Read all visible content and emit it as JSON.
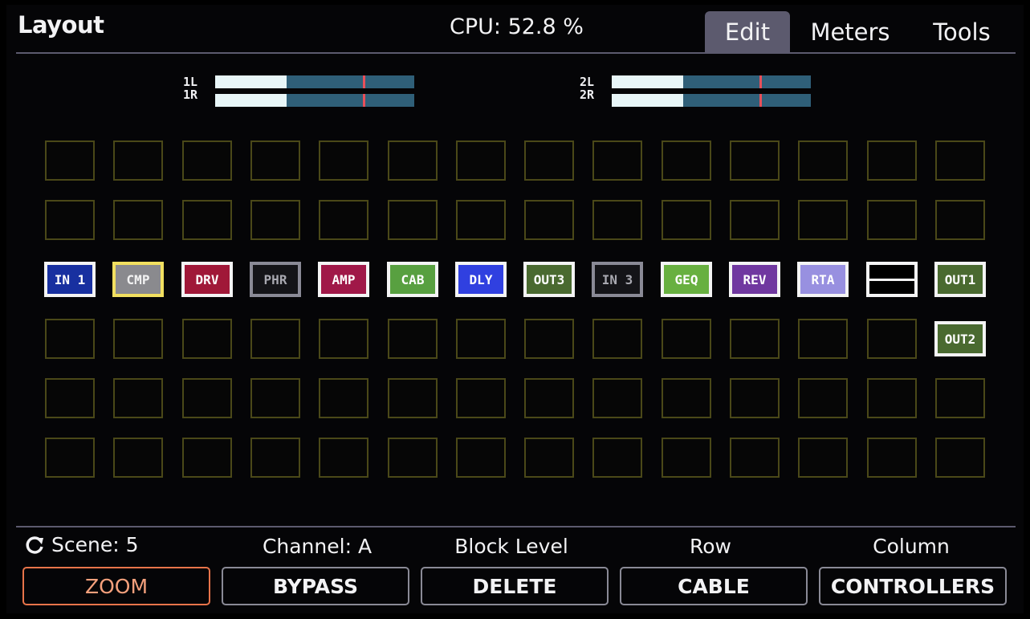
{
  "header": {
    "title": "Layout",
    "cpu": "CPU: 52.8 %",
    "tabs": [
      "Edit",
      "Meters",
      "Tools"
    ],
    "active_tab": "Edit"
  },
  "meters": [
    {
      "label_top": "1L",
      "label_bottom": "1R",
      "level": 0.36,
      "peak": 0.74
    },
    {
      "label_top": "2L",
      "label_bottom": "2R",
      "level": 0.36,
      "peak": 0.74
    }
  ],
  "grid": {
    "rows": 6,
    "columns": 14,
    "blocks": [
      {
        "row": 3,
        "col": 1,
        "label": "IN 1",
        "bg": "#1830a0",
        "border": "#f4f4f4",
        "text": "#ffffff"
      },
      {
        "row": 3,
        "col": 2,
        "label": "CMP",
        "bg": "#8a8a8e",
        "border": "#f2e060",
        "text": "#f2f2f2"
      },
      {
        "row": 3,
        "col": 3,
        "label": "DRV",
        "bg": "#a01838",
        "border": "#f4f4f4",
        "text": "#ffffff"
      },
      {
        "row": 3,
        "col": 4,
        "label": "PHR",
        "bg": "#141418",
        "border": "#8a8a96",
        "text": "#a8a8b0"
      },
      {
        "row": 3,
        "col": 5,
        "label": "AMP",
        "bg": "#a01848",
        "border": "#f4f4f4",
        "text": "#ffffff"
      },
      {
        "row": 3,
        "col": 6,
        "label": "CAB",
        "bg": "#58a040",
        "border": "#f4f4f4",
        "text": "#ffffff"
      },
      {
        "row": 3,
        "col": 7,
        "label": "DLY",
        "bg": "#3040e0",
        "border": "#f4f4f4",
        "text": "#ffffff"
      },
      {
        "row": 3,
        "col": 8,
        "label": "OUT3",
        "bg": "#4a6a30",
        "border": "#f4f4f4",
        "text": "#ffffff"
      },
      {
        "row": 3,
        "col": 9,
        "label": "IN 3",
        "bg": "#141418",
        "border": "#8a8a96",
        "text": "#a8a8b0"
      },
      {
        "row": 3,
        "col": 10,
        "label": "GEQ",
        "bg": "#68b040",
        "border": "#f4f4f4",
        "text": "#ffffff"
      },
      {
        "row": 3,
        "col": 11,
        "label": "REV",
        "bg": "#7038a0",
        "border": "#f4f4f4",
        "text": "#ffffff"
      },
      {
        "row": 3,
        "col": 12,
        "label": "RTA",
        "bg": "#9890e0",
        "border": "#f4f4f4",
        "text": "#ffffff"
      },
      {
        "row": 3,
        "col": 13,
        "label": "",
        "bg": "#000000",
        "border": "#f4f4f4",
        "text": "#ffffff",
        "kind": "shunt"
      },
      {
        "row": 3,
        "col": 14,
        "label": "OUT1",
        "bg": "#4a6a30",
        "border": "#f4f4f4",
        "text": "#ffffff"
      },
      {
        "row": 4,
        "col": 14,
        "label": "OUT2",
        "bg": "#4a6a30",
        "border": "#f4f4f4",
        "text": "#ffffff"
      }
    ],
    "empty_cell_border": "#4a4818"
  },
  "footer": {
    "labels": [
      "Scene: 5",
      "Channel: A",
      "Block Level",
      "Row",
      "Column"
    ],
    "buttons": [
      "ZOOM",
      "BYPASS",
      "DELETE",
      "CABLE",
      "CONTROLLERS"
    ],
    "active_button": "ZOOM",
    "scene_icon": "cycle-arrow-icon"
  },
  "colors": {
    "tab_active": "#5c5a6e",
    "meter_track": "#2f5f78",
    "meter_fill": "#e8f6f8",
    "meter_peak": "#e8505a",
    "active_button_border": "#e8744a"
  }
}
